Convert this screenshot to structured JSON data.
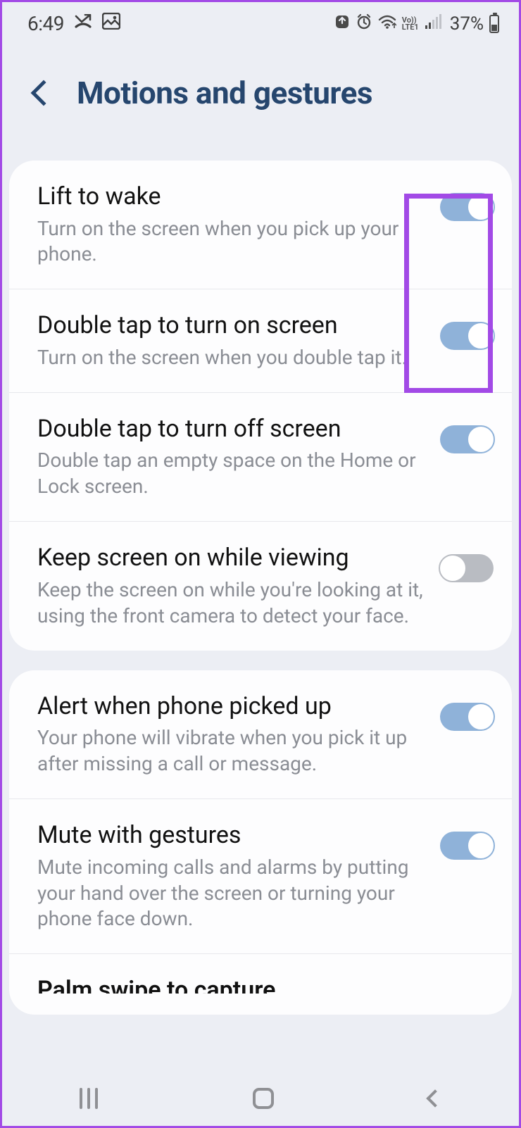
{
  "status": {
    "time": "6:49",
    "battery_pct": "37%",
    "network_label": "LTE1",
    "vo": "Vo))"
  },
  "header": {
    "title": "Motions and gestures"
  },
  "group1": [
    {
      "title": "Lift to wake",
      "desc": "Turn on the screen when you pick up your phone.",
      "on": true
    },
    {
      "title": "Double tap to turn on screen",
      "desc": "Turn on the screen when you double tap it.",
      "on": true
    },
    {
      "title": "Double tap to turn off screen",
      "desc": "Double tap an empty space on the Home or Lock screen.",
      "on": true
    },
    {
      "title": "Keep screen on while viewing",
      "desc": "Keep the screen on while you're looking at it, using the front camera to detect your face.",
      "on": false
    }
  ],
  "group2": [
    {
      "title": "Alert when phone picked up",
      "desc": "Your phone will vibrate when you pick it up after missing a call or message.",
      "on": true
    },
    {
      "title": "Mute with gestures",
      "desc": "Mute incoming calls and alarms by putting your hand over the screen or turning your phone face down.",
      "on": true
    },
    {
      "title": "Palm swipe to capture",
      "desc": "",
      "on": true
    }
  ]
}
